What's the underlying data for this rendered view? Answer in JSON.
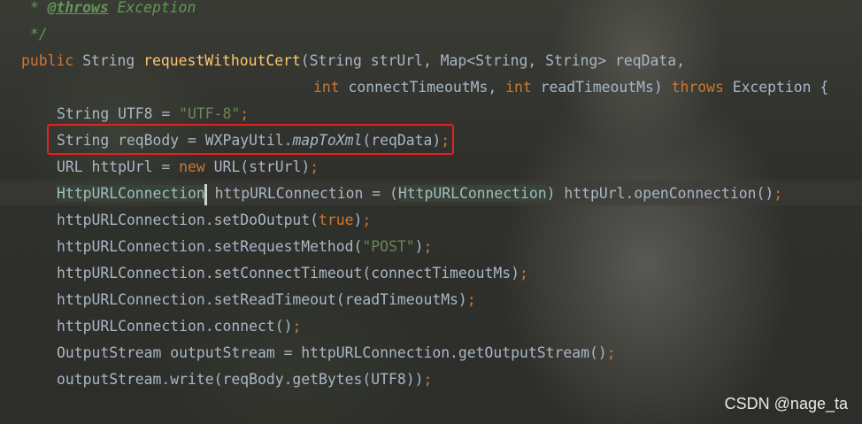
{
  "code": {
    "doc_star": " * ",
    "doc_tag": "@throws",
    "doc_exception": " Exception",
    "doc_close": " */",
    "sig_public": "public",
    "sig_string": " String ",
    "sig_method": "requestWithoutCert",
    "sig_params1": "(String strUrl, Map<String, String> reqData,",
    "sig_int1": "int",
    "sig_param_connect": " connectTimeoutMs, ",
    "sig_int2": "int",
    "sig_param_read": " readTimeoutMs) ",
    "sig_throws": "throws",
    "sig_exception": " Exception {",
    "l_utf8_decl": "String UTF8 = ",
    "l_utf8_value": "\"UTF-8\"",
    "semicolon": ";",
    "l_reqbody_prefix": "String reqBody = WXPayUtil.",
    "l_reqbody_call": "mapToXml",
    "l_reqbody_args": "(reqData)",
    "l_url_decl": "URL httpUrl = ",
    "l_new": "new",
    "l_url_ctor": " URL(strUrl)",
    "l_conn_type": "HttpURLConnection",
    "l_conn_assign_a": " httpURLConnection = ",
    "l_conn_cast_open": "(",
    "l_conn_cast_type": "HttpURLConnection",
    "l_conn_cast_close": ")",
    "l_conn_assign_b": " httpUrl.openConnection()",
    "l_dooutput_call": "httpURLConnection.setDoOutput(",
    "l_true": "true",
    "close_paren": ")",
    "l_method_call": "httpURLConnection.setRequestMethod(",
    "l_post": "\"POST\"",
    "l_connect_timeout": "httpURLConnection.setConnectTimeout(connectTimeoutMs)",
    "l_read_timeout": "httpURLConnection.setReadTimeout(readTimeoutMs)",
    "l_connect": "httpURLConnection.connect()",
    "l_output_stream": "OutputStream outputStream = httpURLConnection.getOutputStream()",
    "l_write": "outputStream.write(reqBody.getBytes(UTF8))"
  },
  "watermark": "CSDN @nage_ta",
  "colors": {
    "keyword": "#cc7832",
    "string": "#6a8759",
    "comment": "#629755",
    "method_decl": "#ffc66d",
    "text": "#a9b7c6",
    "highlight_box": "#e52020"
  }
}
